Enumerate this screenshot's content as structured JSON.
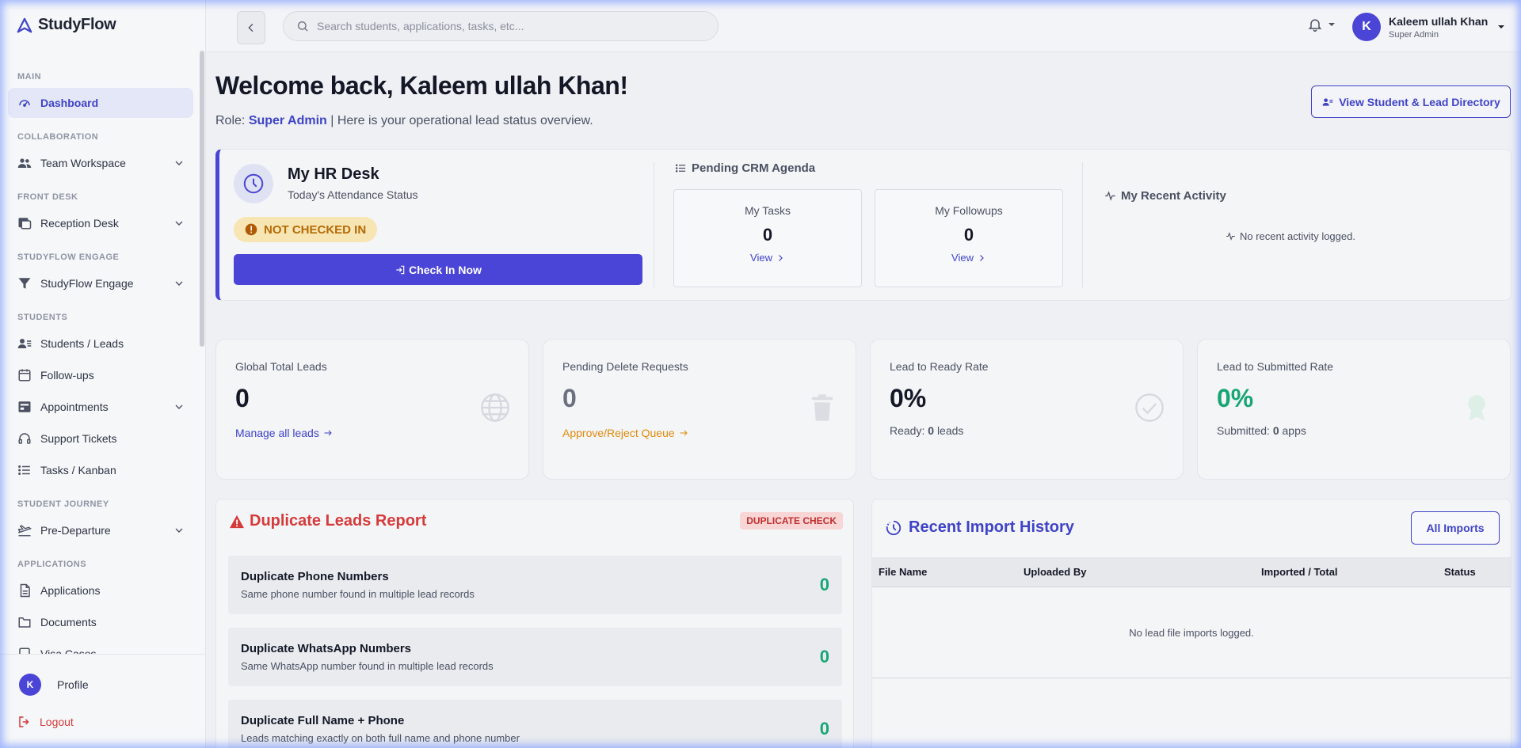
{
  "app": {
    "name": "StudyFlow"
  },
  "sidebar": {
    "sections": [
      {
        "title": "MAIN",
        "items": [
          {
            "label": "Dashboard",
            "icon": "dashboard-icon",
            "active": true,
            "expandable": false
          }
        ]
      },
      {
        "title": "COLLABORATION",
        "items": [
          {
            "label": "Team Workspace",
            "icon": "team-icon",
            "expandable": true
          }
        ]
      },
      {
        "title": "FRONT DESK",
        "items": [
          {
            "label": "Reception Desk",
            "icon": "reception-icon",
            "expandable": true
          }
        ]
      },
      {
        "title": "STUDYFLOW ENGAGE",
        "items": [
          {
            "label": "StudyFlow Engage",
            "icon": "filter-icon",
            "expandable": true
          }
        ]
      },
      {
        "title": "STUDENTS",
        "items": [
          {
            "label": "Students / Leads",
            "icon": "students-icon",
            "expandable": false
          },
          {
            "label": "Follow-ups",
            "icon": "calendar-icon",
            "expandable": false
          },
          {
            "label": "Appointments",
            "icon": "appointments-icon",
            "expandable": true
          },
          {
            "label": "Support Tickets",
            "icon": "headset-icon",
            "expandable": false
          },
          {
            "label": "Tasks / Kanban",
            "icon": "list-icon",
            "expandable": false
          }
        ]
      },
      {
        "title": "STUDENT JOURNEY",
        "items": [
          {
            "label": "Pre-Departure",
            "icon": "plane-icon",
            "expandable": true
          }
        ]
      },
      {
        "title": "APPLICATIONS",
        "items": [
          {
            "label": "Applications",
            "icon": "document-icon",
            "expandable": false
          },
          {
            "label": "Documents",
            "icon": "folder-icon",
            "expandable": false
          },
          {
            "label": "Visa Cases",
            "icon": "visa-icon",
            "expandable": false
          }
        ]
      }
    ],
    "profile_label": "Profile",
    "profile_initial": "K",
    "logout_label": "Logout"
  },
  "topbar": {
    "search_placeholder": "Search students, applications, tasks, etc...",
    "user_initial": "K",
    "user_name": "Kaleem ullah Khan",
    "user_role": "Super Admin"
  },
  "header": {
    "welcome": "Welcome back, Kaleem ullah Khan!",
    "role_prefix": "Role:",
    "role_value": "Super Admin",
    "role_suffix": "| Here is your operational lead status overview.",
    "directory_button": "View Student & Lead Directory"
  },
  "hr_desk": {
    "title": "My HR Desk",
    "subtitle": "Today's Attendance Status",
    "status": "NOT CHECKED IN",
    "check_in_label": "Check In Now"
  },
  "agenda": {
    "title": "Pending CRM Agenda",
    "tasks": {
      "label": "My Tasks",
      "value": "0",
      "link": "View"
    },
    "followups": {
      "label": "My Followups",
      "value": "0",
      "link": "View"
    }
  },
  "activity": {
    "title": "My Recent Activity",
    "empty": "No recent activity logged."
  },
  "stats": [
    {
      "label": "Global Total Leads",
      "value": "0",
      "link": "Manage all leads",
      "icon": "globe-icon"
    },
    {
      "label": "Pending Delete Requests",
      "value": "0",
      "link": "Approve/Reject Queue",
      "icon": "trash-icon"
    },
    {
      "label": "Lead to Ready Rate",
      "value": "0%",
      "note_prefix": "Ready:",
      "note_value": "0",
      "note_suffix": "leads",
      "icon": "check-circle-icon"
    },
    {
      "label": "Lead to Submitted Rate",
      "value": "0%",
      "note_prefix": "Submitted:",
      "note_value": "0",
      "note_suffix": "apps",
      "icon": "award-icon"
    }
  ],
  "duplicates": {
    "title": "Duplicate Leads Report",
    "badge": "DUPLICATE CHECK",
    "rows": [
      {
        "title": "Duplicate Phone Numbers",
        "subtitle": "Same phone number found in multiple lead records",
        "value": "0"
      },
      {
        "title": "Duplicate WhatsApp Numbers",
        "subtitle": "Same WhatsApp number found in multiple lead records",
        "value": "0"
      },
      {
        "title": "Duplicate Full Name + Phone",
        "subtitle": "Leads matching exactly on both full name and phone number",
        "value": "0"
      }
    ]
  },
  "imports": {
    "title": "Recent Import History",
    "button": "All Imports",
    "columns": [
      "File Name",
      "Uploaded By",
      "Imported / Total",
      "Status"
    ],
    "empty": "No lead file imports logged."
  },
  "colors": {
    "accent": "#4a45d6",
    "danger": "#d63a3a",
    "success": "#17a673",
    "warning": "#e08a0b"
  }
}
